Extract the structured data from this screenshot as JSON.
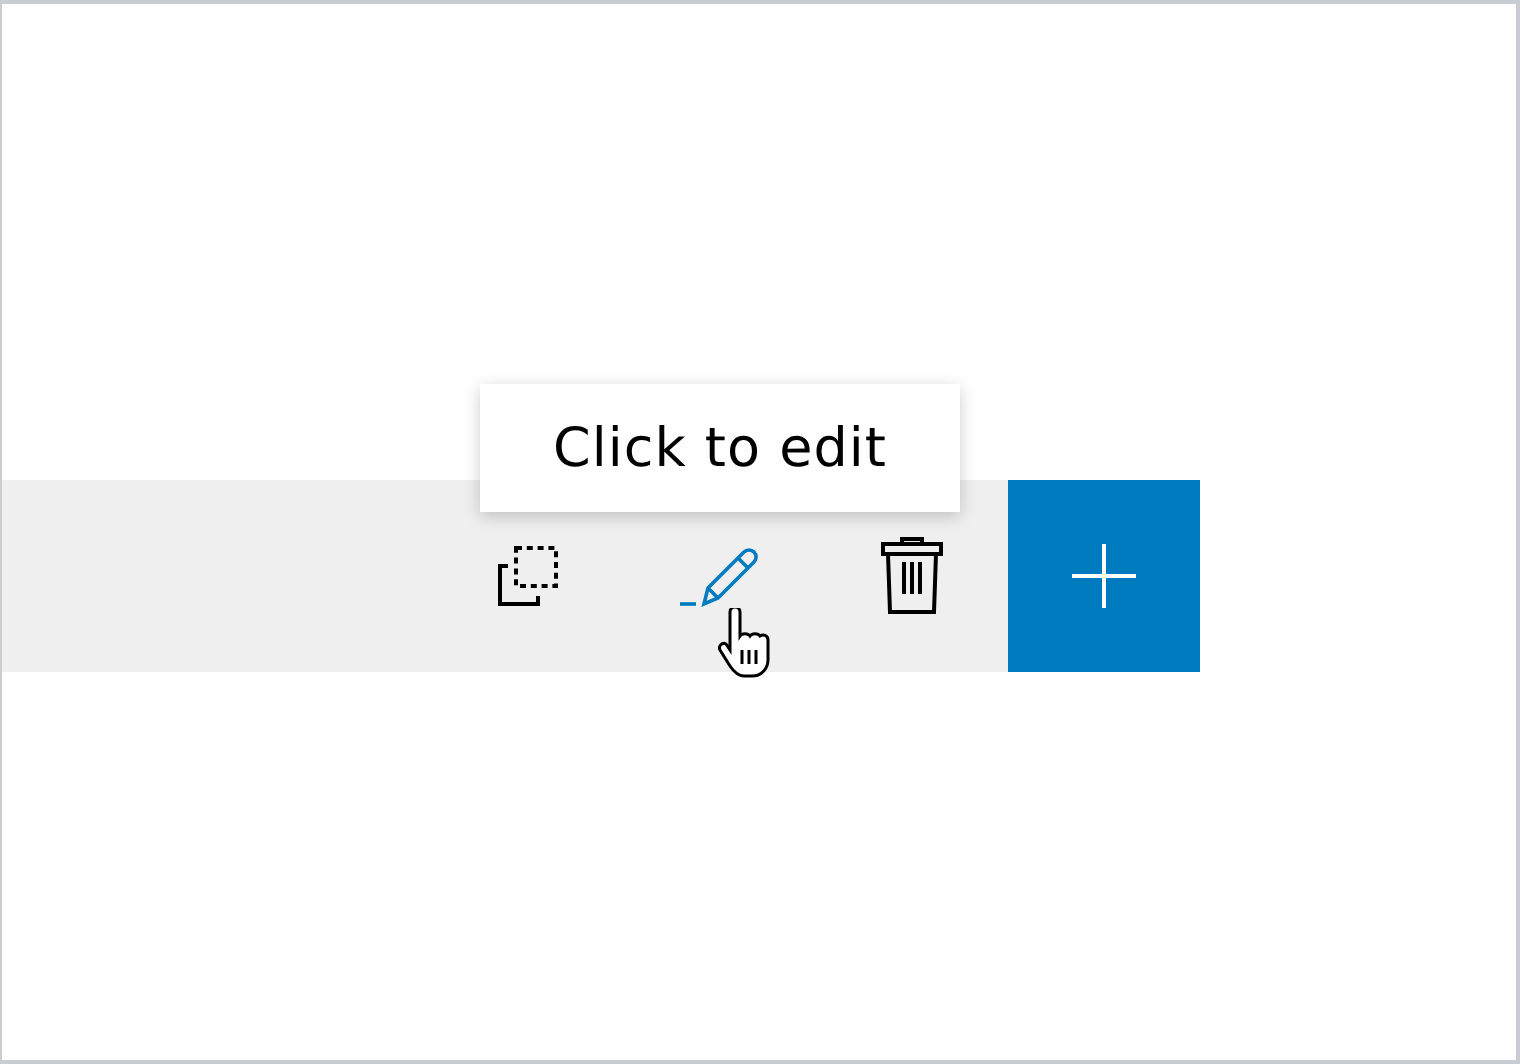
{
  "tooltip": {
    "text": "Click to edit"
  },
  "actions": [
    {
      "kind": "copy",
      "hovered": false
    },
    {
      "kind": "edit",
      "hovered": true
    },
    {
      "kind": "delete",
      "hovered": false
    }
  ],
  "add_button": {
    "kind": "add"
  }
}
